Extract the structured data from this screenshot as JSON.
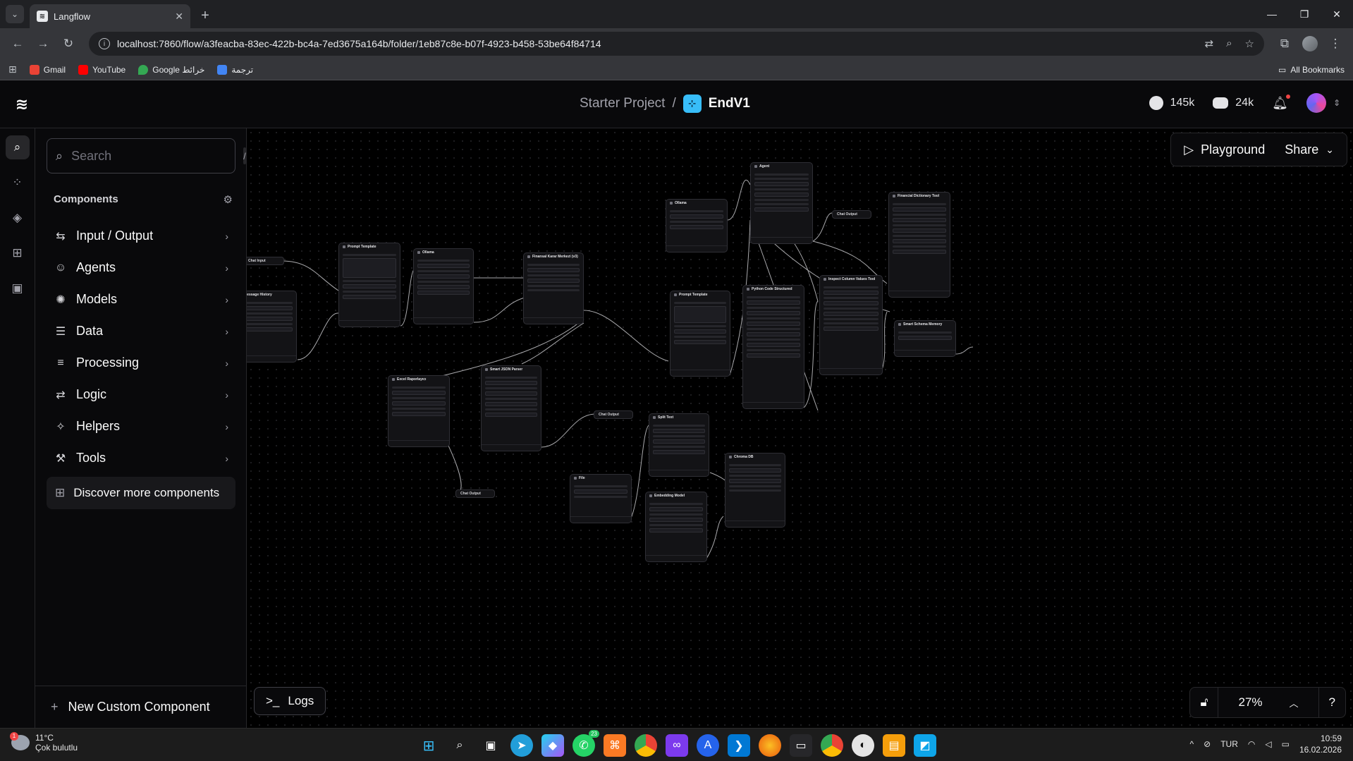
{
  "browser": {
    "tab_title": "Langflow",
    "url": "localhost:7860/flow/a3feacba-83ec-422b-bc4a-7ed3675a164b/folder/1eb87c8e-b07f-4923-b458-53be64f84714",
    "bookmarks": [
      "Gmail",
      "YouTube",
      "Google خرائط",
      "ترجمة"
    ],
    "all_bookmarks": "All Bookmarks"
  },
  "header": {
    "project": "Starter Project",
    "separator": "/",
    "flow_name": "EndV1",
    "github_stars": "145k",
    "discord_members": "24k"
  },
  "sidebar": {
    "search_placeholder": "Search",
    "search_shortcut": "/",
    "components_title": "Components",
    "categories": [
      {
        "label": "Input / Output",
        "icon": "io-icon"
      },
      {
        "label": "Agents",
        "icon": "bot-icon"
      },
      {
        "label": "Models",
        "icon": "brain-icon"
      },
      {
        "label": "Data",
        "icon": "database-icon"
      },
      {
        "label": "Processing",
        "icon": "filter-icon"
      },
      {
        "label": "Logic",
        "icon": "arrows-icon"
      },
      {
        "label": "Helpers",
        "icon": "wand-icon"
      },
      {
        "label": "Tools",
        "icon": "hammer-icon"
      }
    ],
    "discover": "Discover more components",
    "new_custom": "New Custom Component"
  },
  "canvas": {
    "playground": "Playground",
    "share": "Share",
    "logs": "Logs",
    "zoom": "27%",
    "nodes": [
      {
        "id": "chat-input",
        "title": "Chat Input"
      },
      {
        "id": "message-history",
        "title": "Message History"
      },
      {
        "id": "prompt-template-1",
        "title": "Prompt Template"
      },
      {
        "id": "ollama-1",
        "title": "Ollama"
      },
      {
        "id": "finansal-karar",
        "title": "Finansal Karar Merkezi (v3)"
      },
      {
        "id": "excel-raporlayici",
        "title": "Excel Raporlayıcı"
      },
      {
        "id": "smart-json",
        "title": "Smart JSON Parser"
      },
      {
        "id": "chat-output-1",
        "title": "Chat Output"
      },
      {
        "id": "chat-output-2",
        "title": "Chat Output"
      },
      {
        "id": "file",
        "title": "File"
      },
      {
        "id": "split-text",
        "title": "Split Text"
      },
      {
        "id": "embedding-model",
        "title": "Embedding Model"
      },
      {
        "id": "chroma-db",
        "title": "Chroma DB"
      },
      {
        "id": "prompt-template-2",
        "title": "Prompt Template"
      },
      {
        "id": "legacy-python",
        "title": "Python Code Structured"
      },
      {
        "id": "ollama-2",
        "title": "Ollama"
      },
      {
        "id": "agent",
        "title": "Agent"
      },
      {
        "id": "chat-output-3",
        "title": "Chat Output"
      },
      {
        "id": "inspect-column",
        "title": "Inspect Column Values Tool"
      },
      {
        "id": "financial-dictionary",
        "title": "Financial Dictionary Tool"
      },
      {
        "id": "smart-schema",
        "title": "Smart Schema Memory"
      }
    ]
  },
  "taskbar": {
    "temperature": "11°C",
    "weather": "Çok bulutlu",
    "weather_badge": "1",
    "language": "TUR",
    "time": "10:59",
    "date": "16.02.2026",
    "whatsapp_badge": "23"
  },
  "colors": {
    "edge": "#d4d4d8",
    "handle": "#8b5cf6",
    "handle_red": "#ef4444",
    "flow_icon": "#38bdf8"
  }
}
